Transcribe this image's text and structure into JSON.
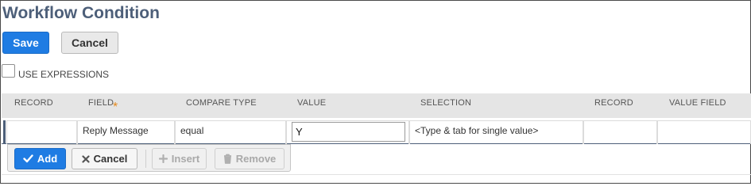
{
  "page": {
    "title": "Workflow Condition"
  },
  "actions": {
    "save_label": "Save",
    "cancel_label": "Cancel"
  },
  "expressions": {
    "label": "USE EXPRESSIONS",
    "checked": false
  },
  "grid": {
    "columns": [
      "RECORD",
      "FIELD",
      "COMPARE TYPE",
      "VALUE",
      "SELECTION",
      "RECORD",
      "VALUE FIELD"
    ],
    "rows": [
      {
        "record": "",
        "field": "Reply Message",
        "compare_type": "equal",
        "value": "Y",
        "selection": "<Type & tab for single value>",
        "record2": "",
        "value_field": ""
      }
    ]
  },
  "row_toolbar": {
    "add_label": "Add",
    "cancel_label": "Cancel",
    "insert_label": "Insert",
    "remove_label": "Remove"
  },
  "icons": {
    "add": "check-icon",
    "cancel": "x-icon",
    "insert": "plus-icon",
    "remove": "trash-icon",
    "required": "asterisk-icon"
  },
  "colors": {
    "primary": "#1f7ce3",
    "title": "#4d5f79",
    "required": "#e58a1f",
    "header_bg": "#e5e5e5"
  }
}
